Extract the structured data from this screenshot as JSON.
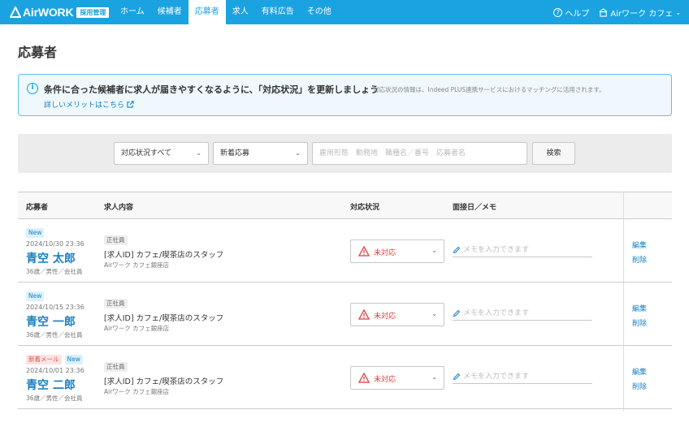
{
  "header": {
    "logo_text": "AirWORK",
    "logo_badge": "採用管理",
    "nav": [
      {
        "label": "ホーム",
        "active": false
      },
      {
        "label": "候補者",
        "active": false
      },
      {
        "label": "応募者",
        "active": true
      },
      {
        "label": "求人",
        "active": false
      },
      {
        "label": "有料広告",
        "active": false
      },
      {
        "label": "その他",
        "active": false
      }
    ],
    "help_label": "ヘルプ",
    "account_label": "Airワーク カフェ"
  },
  "page": {
    "title": "応募者"
  },
  "banner": {
    "main_text": "条件に合った候補者に求人が届きやすくなるように、「対応状況」を更新しましょう",
    "sub_text": "対応状況の情報は、Indeed PLUS連携サービスにおけるマッチングに活用されます。",
    "link_text": "詳しいメリットはこちら"
  },
  "filter": {
    "status_select": "対応状況すべて",
    "sort_select": "新着応募",
    "search_placeholder": "雇用形態　勤務地　職種名／番号　応募者名",
    "search_button": "検索"
  },
  "table": {
    "headers": {
      "applicant": "応募者",
      "job": "求人内容",
      "status": "対応状況",
      "memo": "面接日／メモ"
    },
    "rows": [
      {
        "badges": [
          "New"
        ],
        "date": "2024/10/30 23:36",
        "name": "青空 太郎",
        "meta": "36歳／男性／会社員",
        "job_type": "正社員",
        "job_title": "[求人ID] カフェ/喫茶店のスタッフ",
        "job_store": "Airワーク カフェ銀座店",
        "status": "未対応",
        "memo_placeholder": "メモを入力できます",
        "edit": "編集",
        "delete": "削除"
      },
      {
        "badges": [
          "New"
        ],
        "date": "2024/10/15 23:36",
        "name": "青空 一郎",
        "meta": "36歳／男性／会社員",
        "job_type": "正社員",
        "job_title": "[求人ID] カフェ/喫茶店のスタッフ",
        "job_store": "Airワーク カフェ銀座店",
        "status": "未対応",
        "memo_placeholder": "メモを入力できます",
        "edit": "編集",
        "delete": "削除"
      },
      {
        "badges": [
          "新着メール",
          "New"
        ],
        "date": "2024/10/01 23:36",
        "name": "青空 二郎",
        "meta": "36歳／男性／会社員",
        "job_type": "正社員",
        "job_title": "[求人ID] カフェ/喫茶店のスタッフ",
        "job_store": "Airワーク カフェ銀座店",
        "status": "未対応",
        "memo_placeholder": "メモを入力できます",
        "edit": "編集",
        "delete": "削除"
      }
    ]
  },
  "colors": {
    "brand": "#1aa3e0",
    "link": "#1a7fc1",
    "status_red": "#e03a3a"
  }
}
